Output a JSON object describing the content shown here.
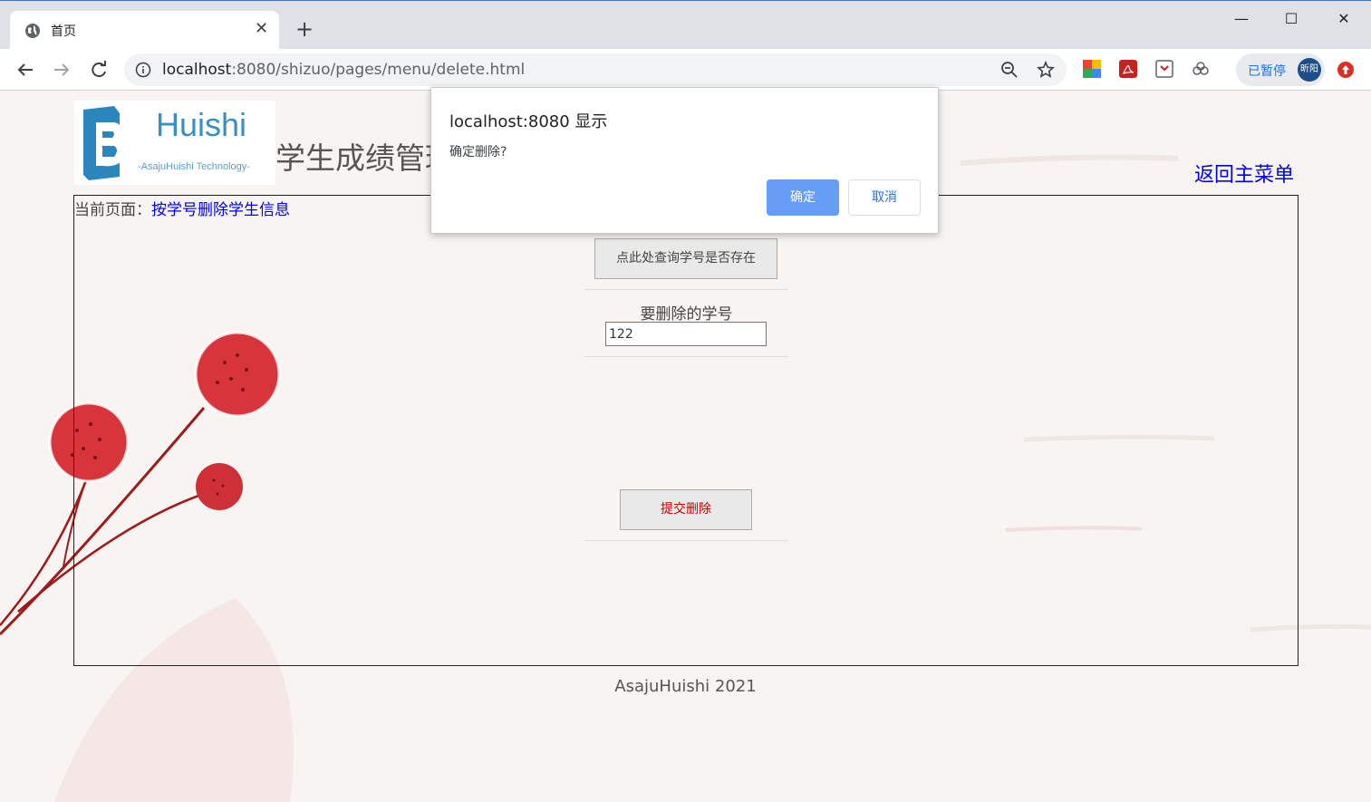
{
  "browser": {
    "tab_title": "首页",
    "tab_close": "✕",
    "new_tab": "+",
    "url_host": "localhost",
    "url_rest": ":8080/shizuo/pages/menu/delete.html",
    "profile_label": "已暂停",
    "avatar_text": "昕阳",
    "window_controls": {
      "minimize": "—",
      "maximize": "☐",
      "close": "✕"
    }
  },
  "page": {
    "logo": {
      "brand": "Huishi",
      "sub": "-AsajuHuishi Technology-"
    },
    "system_title": "学生成绩管理",
    "back_link": "返回主菜单",
    "crumb_prefix": "当前页面：",
    "crumb_current": "按学号删除学生信息",
    "query_button": "点此处查询学号是否存在",
    "field_label": "要删除的学号",
    "student_id_value": "122",
    "submit_button": "提交删除",
    "footer": "AsajuHuishi 2021"
  },
  "dialog": {
    "title": "localhost:8080 显示",
    "message": "确定删除?",
    "ok_label": "确定",
    "cancel_label": "取消"
  },
  "colors": {
    "link": "#0000ee",
    "dialog_ok": "#669df6",
    "submit_text": "#cc0000",
    "logo_blue": "#3a8fc1"
  }
}
